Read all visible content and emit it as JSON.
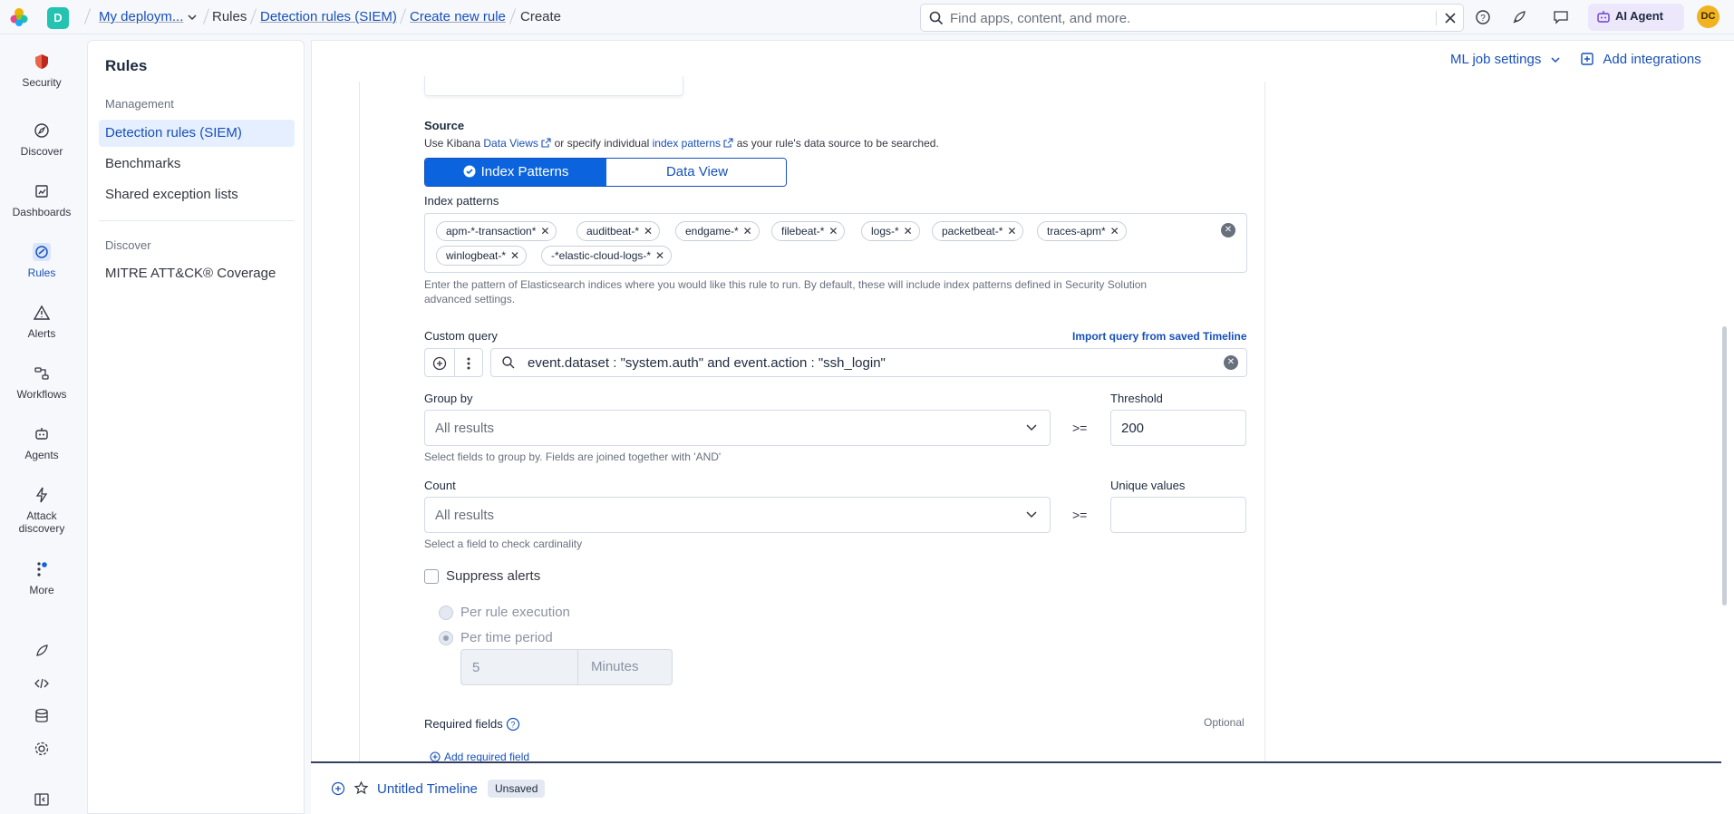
{
  "header": {
    "space_initial": "D",
    "breadcrumbs": [
      "My deploym...",
      "Rules",
      "Detection rules (SIEM)",
      "Create new rule",
      "Create"
    ],
    "search_placeholder": "Find apps, content, and more.",
    "ai_agent_label": "AI Agent",
    "user_initials": "DC"
  },
  "rail": {
    "items": [
      {
        "label": "Security",
        "icon": "security-shield-icon"
      },
      {
        "label": "Discover",
        "icon": "discover-compass-icon"
      },
      {
        "label": "Dashboards",
        "icon": "dashboard-icon"
      },
      {
        "label": "Rules",
        "icon": "rules-icon"
      },
      {
        "label": "Alerts",
        "icon": "warning-triangle-icon"
      },
      {
        "label": "Workflows",
        "icon": "workflows-icon"
      },
      {
        "label": "Agents",
        "icon": "robot-icon"
      },
      {
        "label": "Attack",
        "label2": "discovery",
        "icon": "lightning-icon"
      },
      {
        "label": "More",
        "icon": "more-icon"
      }
    ]
  },
  "subnav": {
    "title": "Rules",
    "group_management": "Management",
    "items_management": [
      "Detection rules (SIEM)",
      "Benchmarks",
      "Shared exception lists"
    ],
    "group_discover": "Discover",
    "items_discover": [
      "MITRE ATT&CK® Coverage"
    ]
  },
  "page_actions": {
    "ml_job_settings": "ML job settings",
    "add_integrations": "Add integrations"
  },
  "form": {
    "source_label": "Source",
    "source_help_prefix": "Use Kibana",
    "source_link_data_views": "Data Views",
    "source_help_middle": "or specify individual",
    "source_link_index_patterns": "index patterns",
    "source_help_suffix": "as your rule's data source to be searched.",
    "tab_index_patterns": "Index Patterns",
    "tab_data_view": "Data View",
    "index_patterns_label": "Index patterns",
    "index_patterns": [
      "apm-*-transaction*",
      "auditbeat-*",
      "endgame-*",
      "filebeat-*",
      "logs-*",
      "packetbeat-*",
      "traces-apm*",
      "winlogbeat-*",
      "-*elastic-cloud-logs-*"
    ],
    "index_patterns_help_1": "Enter the pattern of Elasticsearch indices where you would like this rule to run. By default, these will include index patterns defined in Security Solution",
    "index_patterns_help_2": "advanced settings.",
    "custom_query_label": "Custom query",
    "import_query_link": "Import query from saved Timeline",
    "query_value": "event.dataset : \"system.auth\" and event.action : \"ssh_login\"",
    "group_by_label": "Group by",
    "group_by_placeholder": "All results",
    "group_by_help": "Select fields to group by. Fields are joined together with 'AND'",
    "gte": ">=",
    "threshold_label": "Threshold",
    "threshold_value": "200",
    "count_label": "Count",
    "count_placeholder": "All results",
    "count_help": "Select a field to check cardinality",
    "unique_values_label": "Unique values",
    "suppress_alerts_label": "Suppress alerts",
    "per_rule_execution": "Per rule execution",
    "per_time_period": "Per time period",
    "duration_value": "5",
    "duration_unit": "Minutes",
    "required_fields_label": "Required fields",
    "optional_label": "Optional",
    "add_required_field": "Add required field"
  },
  "timeline": {
    "title": "Untitled Timeline",
    "badge": "Unsaved"
  },
  "colors": {
    "accent": "#0b64dd",
    "link": "#1750ba",
    "ai_agent_bg": "#ece7fb",
    "space_avatar": "#24c2b0",
    "user_avatar": "#f1b31f"
  }
}
